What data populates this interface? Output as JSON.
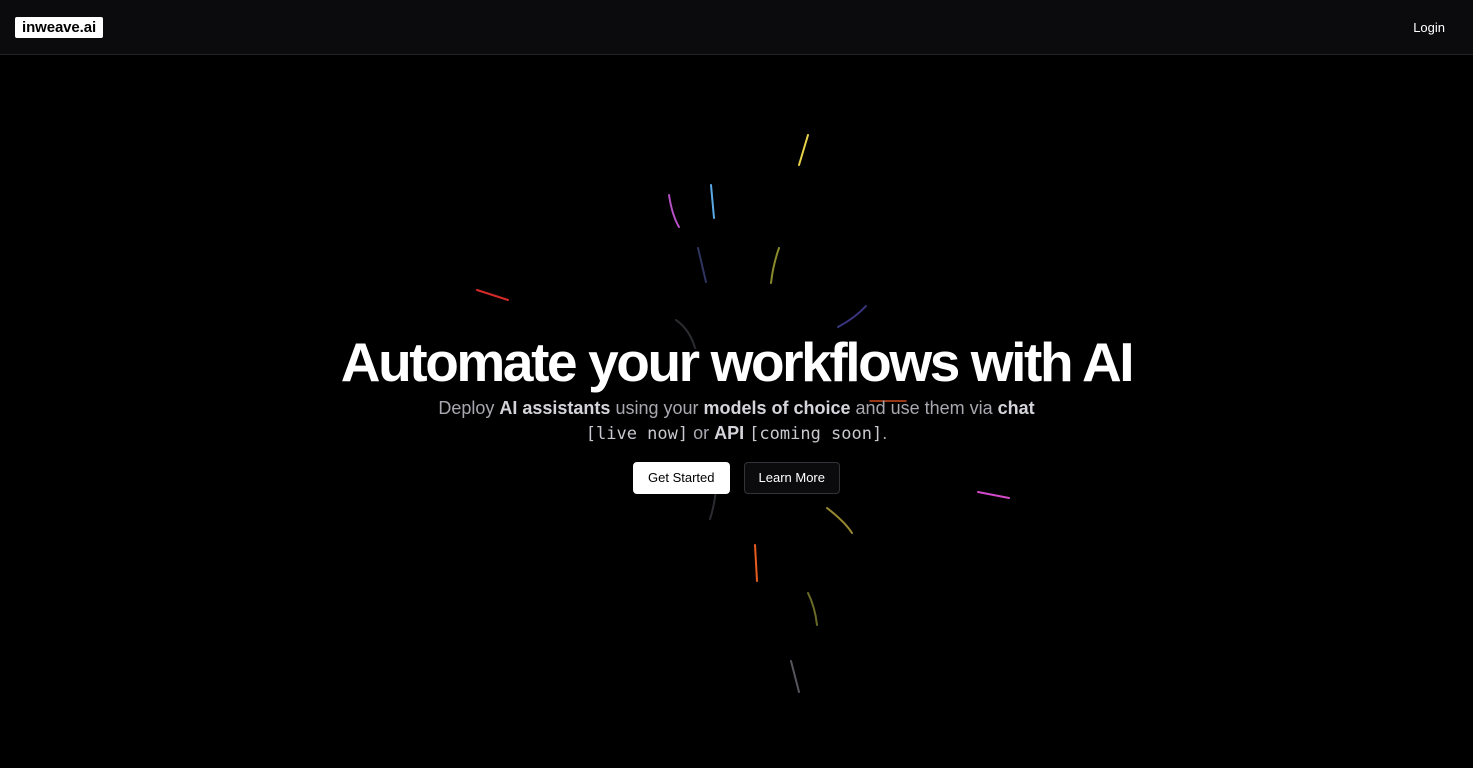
{
  "nav": {
    "logo": "inweave.ai",
    "login": "Login"
  },
  "hero": {
    "headline": "Automate your workflows with AI",
    "sub": {
      "p1": "Deploy ",
      "b1": "AI assistants",
      "p2": " using your ",
      "b2": "models of choice",
      "p3": " and use them via ",
      "b3": "chat",
      "m1": "[live now]",
      "p4": " or ",
      "b4": "API",
      "m2": "[coming soon]",
      "p5": "."
    },
    "get_started": "Get Started",
    "learn_more": "Learn More"
  },
  "colors": {
    "background": "#000000",
    "navbar": "#0b0b0d",
    "primary_button": "#ffffff",
    "spark_yellow": "#e8d34a",
    "spark_blue": "#5aa9e6",
    "spark_purple": "#b44fc4",
    "spark_red": "#d42a2a",
    "spark_magenta": "#d24bc9",
    "spark_orange": "#e85d1f",
    "spark_olive": "#8a8a2c"
  }
}
